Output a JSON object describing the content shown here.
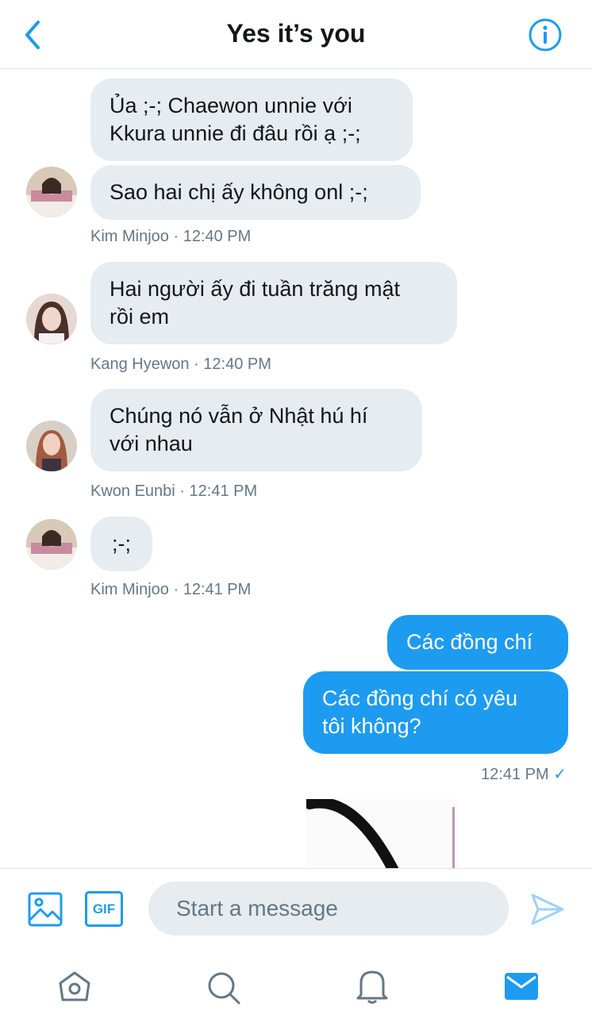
{
  "header": {
    "title": "Yes it’s you"
  },
  "messages": [
    {
      "text": "Ủa ;-; Chaewon unnie với\nKkura unnie đi đâu rồi ạ ;-;"
    },
    {
      "text": "Sao hai chị ấy không onl ;-;"
    },
    {
      "meta": "Kim Minjoo · 12:40 PM"
    },
    {
      "text": "Hai người ấy đi tuần trăng mật\nrồi em"
    },
    {
      "meta": "Kang Hyewon · 12:40 PM"
    },
    {
      "text": "Chúng nó vẫn ở Nhật hú hí\nvới nhau"
    },
    {
      "meta": "Kwon Eunbi · 12:41 PM"
    },
    {
      "text": ";-;"
    },
    {
      "meta": "Kim Minjoo · 12:41 PM"
    },
    {
      "text": "Các đồng chí"
    },
    {
      "text": "Các đồng chí có yêu\ntôi không?"
    },
    {
      "meta": "12:41 PM",
      "check": "✓"
    }
  ],
  "composer": {
    "placeholder": "Start a message",
    "gif_label": "GIF"
  },
  "colors": {
    "accent": "#1d9bf0",
    "bubble_in": "#e6ecf0",
    "meta": "#657786"
  },
  "icons": [
    "back-icon",
    "info-icon",
    "image-icon",
    "gif-icon",
    "send-icon",
    "home-icon",
    "search-icon",
    "notifications-icon",
    "messages-icon"
  ]
}
